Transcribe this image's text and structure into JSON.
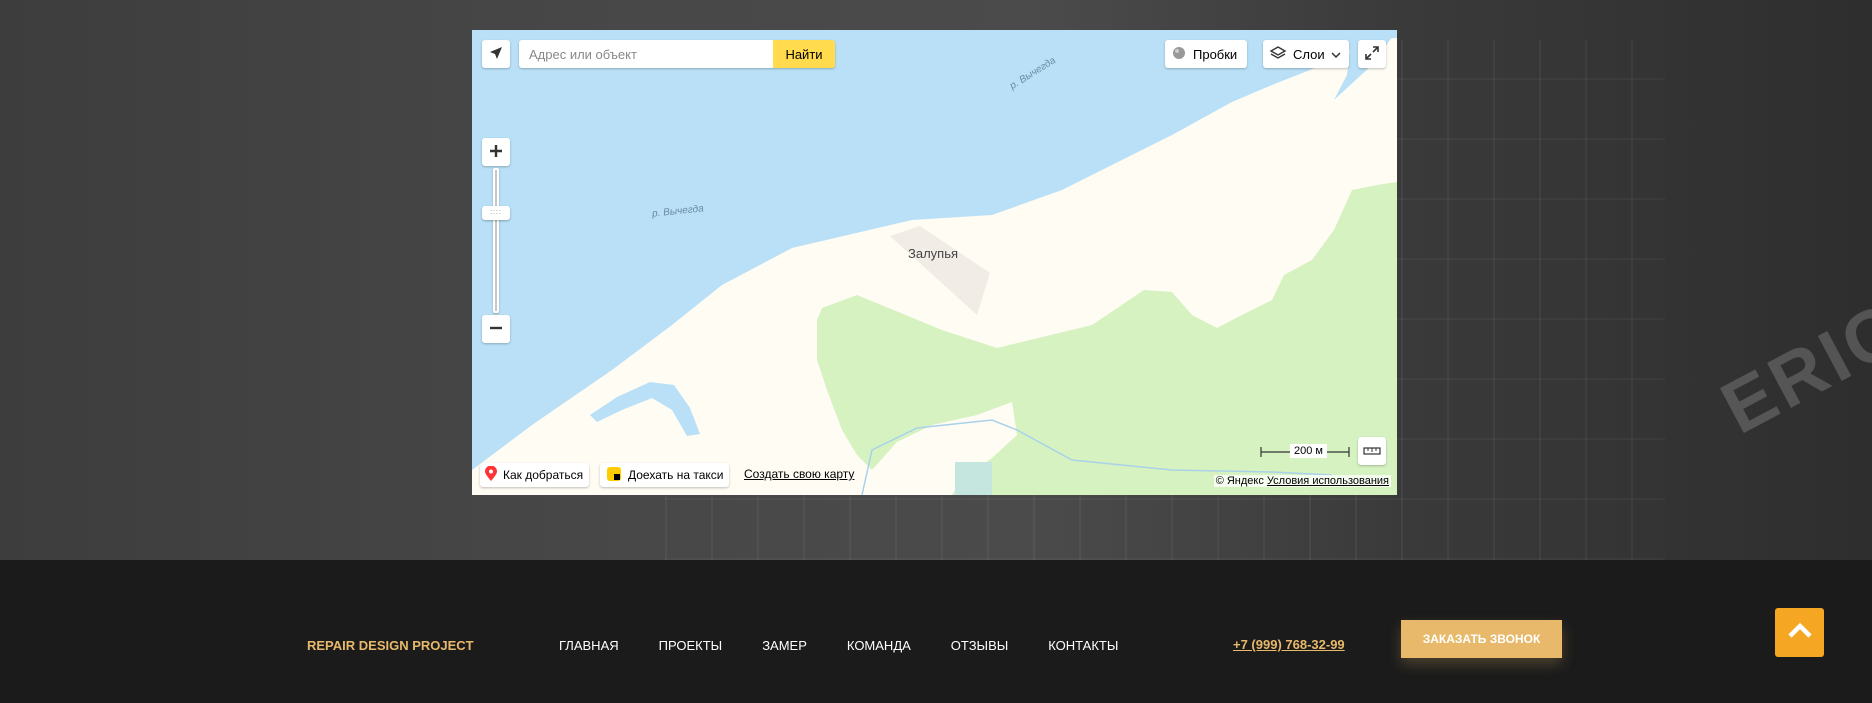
{
  "map": {
    "search": {
      "placeholder": "Адрес или объект",
      "button_label": "Найти"
    },
    "traffic_label": "Пробки",
    "layers_label": "Слои",
    "route_label": "Как добраться",
    "taxi_label": "Доехать на такси",
    "create_map_label": "Создать свою карту",
    "scale_label": "200 м",
    "copyright": "© Яндекс",
    "terms_label": "Условия использования",
    "labels": {
      "river_1": "р. Вычегда",
      "river_2": "р. Вычегда",
      "town": "Залупья"
    },
    "colors": {
      "water": "#b9e0f7",
      "forest": "#d6f2c1",
      "land": "#fffcf3",
      "accent": "#ffdb4d"
    }
  },
  "footer": {
    "brand": "REPAIR DESIGN PROJECT",
    "nav": [
      "ГЛАВНАЯ",
      "ПРОЕКТЫ",
      "ЗАМЕР",
      "КОМАНДА",
      "ОТЗЫВЫ",
      "КОНТАКТЫ"
    ],
    "phone": "+7 (999) 768-32-99",
    "call_button": "ЗАКАЗАТЬ ЗВОНОК",
    "colors": {
      "brand": "#e8b96b",
      "to_top": "#f5a623"
    }
  },
  "icons": [
    "geolocation-icon",
    "traffic-icon",
    "layers-icon",
    "chevron-down-icon",
    "fullscreen-icon",
    "zoom-in-icon",
    "zoom-out-icon",
    "route-pin-icon",
    "taxi-icon",
    "ruler-icon",
    "arrow-up-icon"
  ]
}
